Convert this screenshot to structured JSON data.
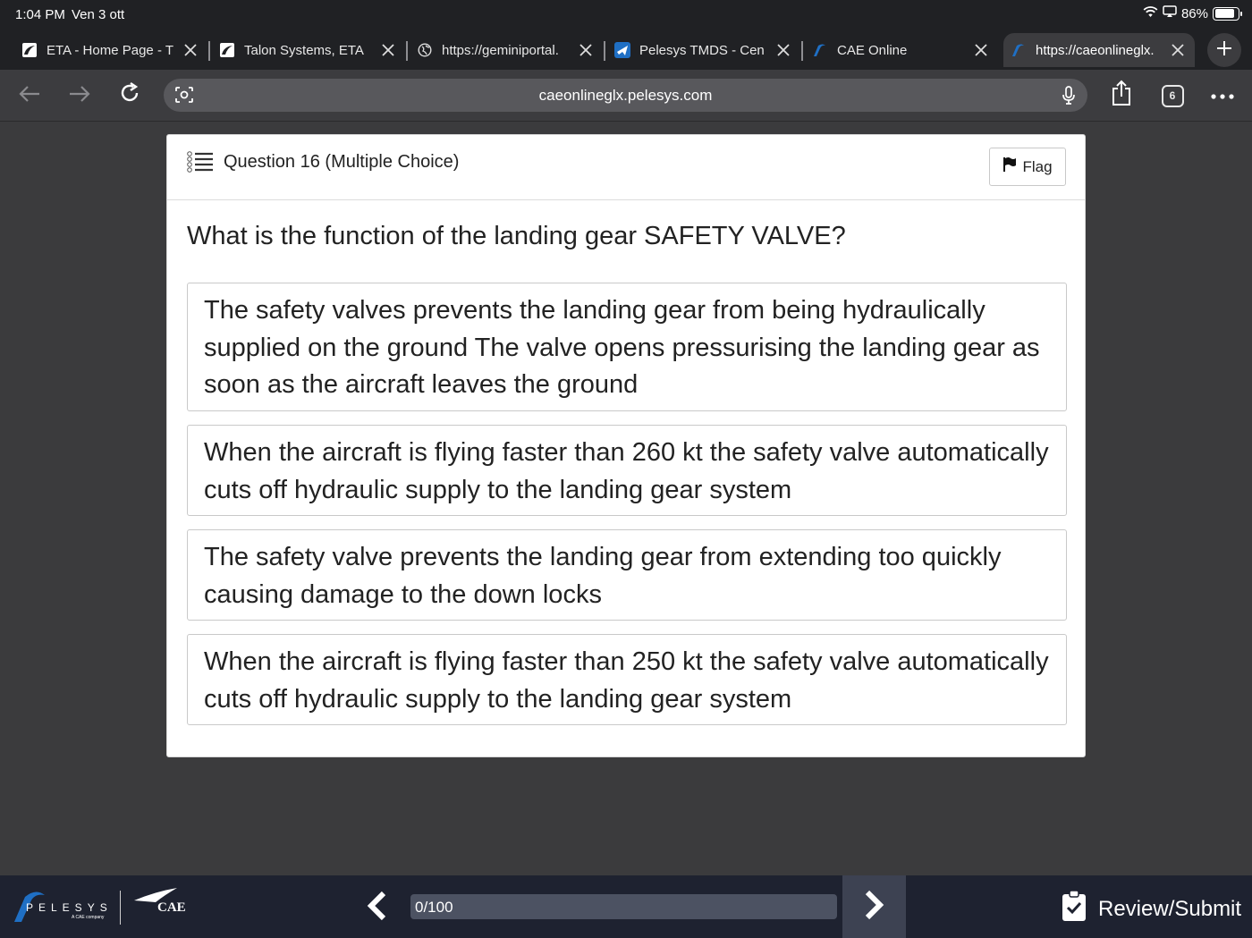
{
  "status_bar": {
    "time": "1:04 PM",
    "date": "Ven 3 ott",
    "battery": "86%",
    "battery_level": 0.86
  },
  "tabs": [
    {
      "label": "ETA - Home Page - T",
      "icon": "eta-logo-icon",
      "active": false
    },
    {
      "label": "Talon Systems, ETA",
      "icon": "eta-logo-icon",
      "active": false
    },
    {
      "label": "https://geminiportal.",
      "icon": "globe-icon",
      "active": false
    },
    {
      "label": "Pelesys TMDS - Cen",
      "icon": "plane-icon",
      "active": false
    },
    {
      "label": "CAE Online",
      "icon": "pelesys-logo-icon",
      "active": false
    },
    {
      "label": "https://caeonlineglx.",
      "icon": "pelesys-logo-icon",
      "active": true
    }
  ],
  "toolbar": {
    "url": "caeonlineglx.pelesys.com",
    "tab_count": "6"
  },
  "question": {
    "header": "Question 16 (Multiple Choice)",
    "flag_label": "Flag",
    "text": "What is the function of the landing gear SAFETY VALVE?",
    "options": [
      "The safety valves prevents the landing gear from being hydraulically supplied on the ground The valve opens pressurising the landing gear as soon as the aircraft leaves the ground",
      "When the aircraft is flying faster than 260 kt the safety valve automatically cuts off hydraulic supply to the landing gear system",
      "The safety valve prevents the landing gear from extending too quickly causing damage to the down locks",
      "When the aircraft is flying faster than 250 kt the safety valve automatically cuts off hydraulic supply to the landing gear system"
    ]
  },
  "footer": {
    "brand": "PELESYS",
    "brand_sub": "A CAE company",
    "partner": "CAE",
    "progress_label": "0/100",
    "progress_value": 0,
    "review_label": "Review/Submit"
  },
  "colors": {
    "chrome_dark": "#202124",
    "page_background": "#3b3b3d",
    "footer_background": "#1e2230",
    "pelesys_blue": "#1f6fc4"
  }
}
